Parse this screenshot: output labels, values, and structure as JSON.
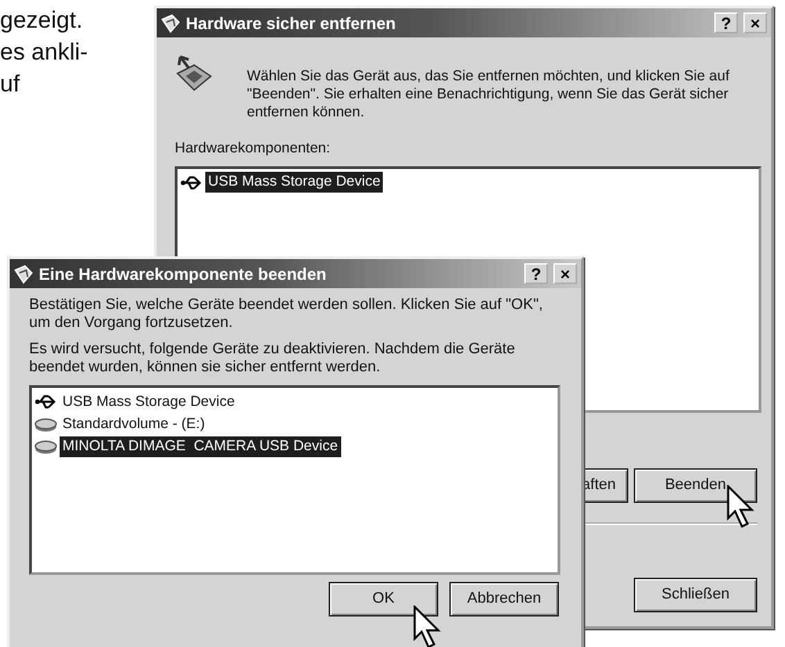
{
  "page_text": [
    "gezeigt.",
    "es ankli-",
    "uf"
  ],
  "back_window": {
    "title": "Hardware sicher entfernen",
    "title_buttons": [
      "?",
      "×"
    ],
    "intro": "Wählen Sie das Gerät aus, das Sie entfernen möchten, und klicken Sie auf \"Beenden\". Sie erhalten eine Benachrichtigung, wenn Sie das Gerät sicher entfernen können.",
    "list_label": "Hardwarekomponenten:",
    "items": [
      {
        "label": "USB Mass Storage Device",
        "kind": "usb",
        "selected": true
      }
    ],
    "buttons": [
      "aften",
      "Beenden",
      "Schließen"
    ]
  },
  "front_window": {
    "title": "Eine Hardwarekomponente beenden",
    "title_buttons": [
      "?",
      "×"
    ],
    "paragraphs": [
      "Bestätigen Sie, welche Geräte beendet werden sollen. Klicken Sie auf \"OK\", um den Vorgang fortzusetzen.",
      "Es wird versucht, folgende Geräte zu deaktivieren. Nachdem die Geräte beendet wurden, können sie sicher entfernt werden."
    ],
    "items": [
      {
        "label": "USB Mass Storage Device",
        "kind": "usb",
        "selected": false
      },
      {
        "label": "Standardvolume - (E:)",
        "kind": "drive",
        "selected": false
      },
      {
        "label": "MINOLTA DIMAGE  CAMERA USB Device",
        "kind": "drive",
        "selected": true
      }
    ],
    "buttons": [
      "OK",
      "Abbrechen"
    ]
  }
}
